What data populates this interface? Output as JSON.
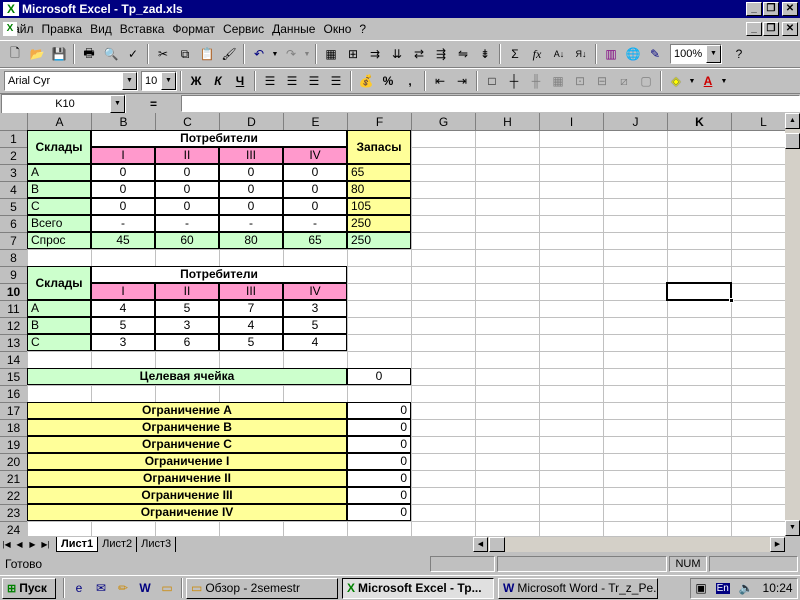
{
  "window": {
    "title": "Microsoft Excel - Tp_zad.xls"
  },
  "menu": [
    "Файл",
    "Правка",
    "Вид",
    "Вставка",
    "Формат",
    "Сервис",
    "Данные",
    "Окно",
    "?"
  ],
  "toolbar": {
    "zoom": "100%"
  },
  "format_toolbar": {
    "font": "Arial Cyr",
    "size": "10",
    "bold": "Ж",
    "italic": "К",
    "underline": "Ч",
    "percent": "%",
    "comma": ","
  },
  "formula_bar": {
    "name_box": "K10",
    "equals": "=",
    "value": ""
  },
  "grid": {
    "columns": [
      "A",
      "B",
      "C",
      "D",
      "E",
      "F",
      "G",
      "H",
      "I",
      "J",
      "K",
      "L"
    ],
    "rows": [
      "1",
      "2",
      "3",
      "4",
      "5",
      "6",
      "7",
      "8",
      "9",
      "10",
      "11",
      "12",
      "13",
      "14",
      "15",
      "16",
      "17",
      "18",
      "19",
      "20",
      "21",
      "22",
      "23",
      "24"
    ],
    "t1_sklady": "Склады",
    "t1_potrebiteli": "Потребители",
    "t1_zapasy": "Запасы",
    "t1_cons": [
      "I",
      "II",
      "III",
      "IV"
    ],
    "t1_rows": [
      {
        "label": "A",
        "vals": [
          "0",
          "0",
          "0",
          "0"
        ],
        "stock": "65"
      },
      {
        "label": "B",
        "vals": [
          "0",
          "0",
          "0",
          "0"
        ],
        "stock": "80"
      },
      {
        "label": "C",
        "vals": [
          "0",
          "0",
          "0",
          "0"
        ],
        "stock": "105"
      },
      {
        "label": "Всего",
        "vals": [
          "-",
          "-",
          "-",
          "-"
        ],
        "stock": "250"
      }
    ],
    "t1_demand": {
      "label": "Спрос",
      "vals": [
        "45",
        "60",
        "80",
        "65"
      ],
      "total": "250"
    },
    "t2_sklady": "Склады",
    "t2_potrebiteli": "Потребители",
    "t2_cons": [
      "I",
      "II",
      "III",
      "IV"
    ],
    "t2_rows": [
      {
        "label": "A",
        "vals": [
          "4",
          "5",
          "7",
          "3"
        ]
      },
      {
        "label": "B",
        "vals": [
          "5",
          "3",
          "4",
          "5"
        ]
      },
      {
        "label": "C",
        "vals": [
          "3",
          "6",
          "5",
          "4"
        ]
      }
    ],
    "target": {
      "label": "Целевая ячейка",
      "value": "0"
    },
    "constraints": [
      {
        "label": "Ограничение A",
        "value": "0"
      },
      {
        "label": "Ограничение B",
        "value": "0"
      },
      {
        "label": "Ограничение C",
        "value": "0"
      },
      {
        "label": "Ограничение I",
        "value": "0"
      },
      {
        "label": "Ограничение II",
        "value": "0"
      },
      {
        "label": "Ограничение III",
        "value": "0"
      },
      {
        "label": "Ограничение IV",
        "value": "0"
      }
    ]
  },
  "sheets": [
    "Лист1",
    "Лист2",
    "Лист3"
  ],
  "active_sheet": "Лист1",
  "status": {
    "ready": "Готово",
    "num": "NUM"
  },
  "taskbar": {
    "start": "Пуск",
    "tasks": [
      "Обзор - 2semestr",
      "Microsoft Excel - Тр...",
      "Microsoft Word - Tr_z_Pe..."
    ],
    "lang": "En",
    "clock": "10:24"
  },
  "colors": {
    "green": "#ccffcc",
    "pink": "#ff99cc",
    "yellow": "#ffff99",
    "title": "#000080"
  }
}
